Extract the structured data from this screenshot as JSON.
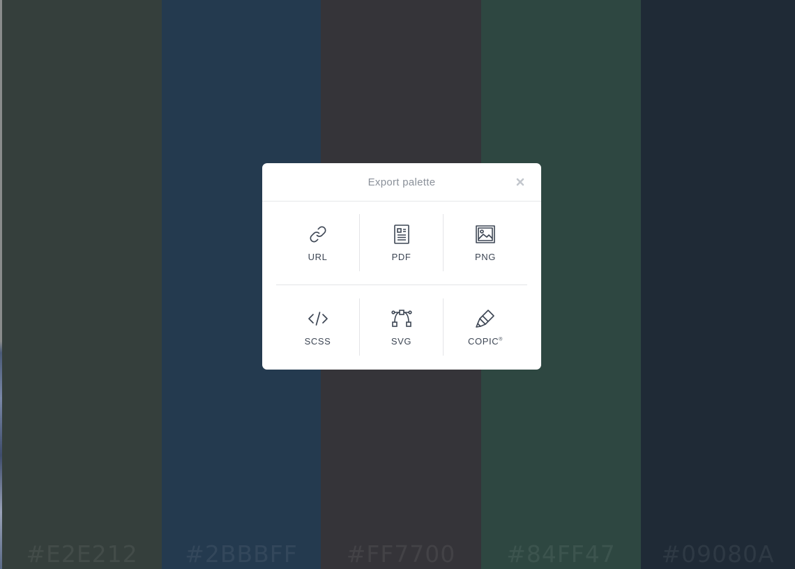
{
  "palette": {
    "columns": [
      {
        "hex": "#E2E212",
        "bg": "#353f3c"
      },
      {
        "hex": "#2BBBFF",
        "bg": "#243a4f"
      },
      {
        "hex": "#FF7700",
        "bg": "#353439"
      },
      {
        "hex": "#84FF47",
        "bg": "#2e4741"
      },
      {
        "hex": "#09080A",
        "bg": "#1f2a36"
      }
    ]
  },
  "modal": {
    "title": "Export palette",
    "close_icon": "close-icon",
    "options": [
      {
        "id": "url",
        "label": "URL",
        "icon": "link-icon"
      },
      {
        "id": "pdf",
        "label": "PDF",
        "icon": "document-icon"
      },
      {
        "id": "png",
        "label": "PNG",
        "icon": "image-icon"
      },
      {
        "id": "scss",
        "label": "SCSS",
        "icon": "code-icon"
      },
      {
        "id": "svg",
        "label": "SVG",
        "icon": "bezier-curve-icon"
      },
      {
        "id": "copic",
        "label": "COPIC",
        "label_mark": "®",
        "icon": "marker-icon"
      }
    ]
  },
  "colors": {
    "icon_stroke": "#3c4553",
    "close_icon": "#c3c7cd"
  }
}
